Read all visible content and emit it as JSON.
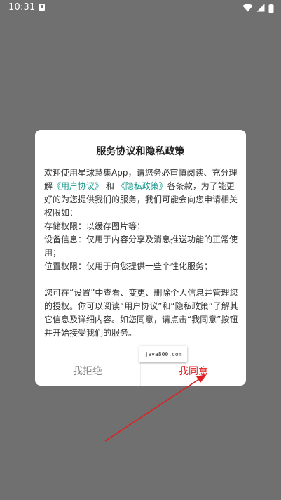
{
  "status_bar": {
    "time": "10:31"
  },
  "dialog": {
    "title": "服务协议和隐私政策",
    "intro_before_link1": "欢迎使用星球慧集App，请您务必审慎阅读、充分理解",
    "link_user_agreement": "《用户协议》",
    "intro_and": "和",
    "link_privacy_policy": "《隐私政策》",
    "intro_after_links": "各条款，为了能更好的为您提供我们的服务，我们可能会向您申请相关权限如：",
    "permissions": [
      "存储权限：以缓存图片等；",
      "设备信息：仅用于内容分享及消息推送功能的正常使用；",
      "位置权限：仅用于向您提供一些个性化服务；"
    ],
    "footer_text": "您可在“设置”中查看、变更、删除个人信息并管理您的授权。你可以阅读“用户协议”和“隐私政策”了解其它信息及详细内容。如您同意，请点击“我同意”按钮并开始接受我们的服务。",
    "decline_label": "我拒绝",
    "agree_label": "我同意"
  },
  "watermark": {
    "text": "java800.com"
  },
  "colors": {
    "overlay": "#707070",
    "link": "#1a9a8c",
    "agree": "#e02020",
    "decline": "#888888",
    "arrow": "#e02020"
  }
}
